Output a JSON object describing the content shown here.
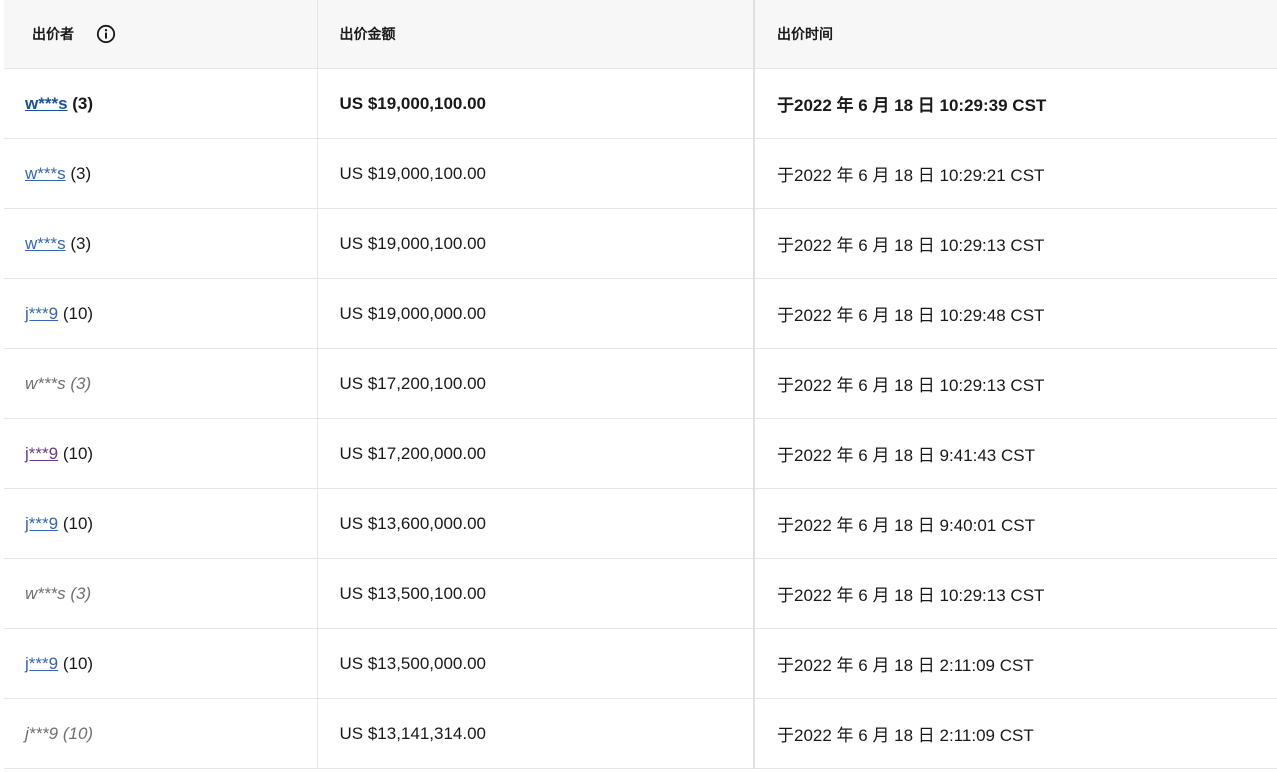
{
  "headers": {
    "bidder": "出价者",
    "amount": "出价金额",
    "time": "出价时间"
  },
  "rows": [
    {
      "bidder": "w***s",
      "feedback": "(3)",
      "amount": "US $19,000,100.00",
      "time": "于2022 年 6 月 18 日 10:29:39 CST",
      "style": "winning"
    },
    {
      "bidder": "w***s",
      "feedback": "(3)",
      "amount": "US $19,000,100.00",
      "time": "于2022 年 6 月 18 日 10:29:21 CST",
      "style": "link"
    },
    {
      "bidder": "w***s",
      "feedback": "(3)",
      "amount": "US $19,000,100.00",
      "time": "于2022 年 6 月 18 日 10:29:13 CST",
      "style": "link"
    },
    {
      "bidder": "j***9",
      "feedback": "(10)",
      "amount": "US $19,000,000.00",
      "time": "于2022 年 6 月 18 日 10:29:48 CST",
      "style": "link"
    },
    {
      "bidder": "w***s",
      "feedback": "(3)",
      "amount": "US $17,200,100.00",
      "time": "于2022 年 6 月 18 日 10:29:13 CST",
      "style": "auto"
    },
    {
      "bidder": "j***9",
      "feedback": "(10)",
      "amount": "US $17,200,000.00",
      "time": "于2022 年 6 月 18 日 9:41:43 CST",
      "style": "visited"
    },
    {
      "bidder": "j***9",
      "feedback": "(10)",
      "amount": "US $13,600,000.00",
      "time": "于2022 年 6 月 18 日 9:40:01 CST",
      "style": "link"
    },
    {
      "bidder": "w***s",
      "feedback": "(3)",
      "amount": "US $13,500,100.00",
      "time": "于2022 年 6 月 18 日 10:29:13 CST",
      "style": "auto"
    },
    {
      "bidder": "j***9",
      "feedback": "(10)",
      "amount": "US $13,500,000.00",
      "time": "于2022 年 6 月 18 日 2:11:09 CST",
      "style": "link"
    },
    {
      "bidder": "j***9",
      "feedback": "(10)",
      "amount": "US $13,141,314.00",
      "time": "于2022 年 6 月 18 日 2:11:09 CST",
      "style": "auto"
    }
  ],
  "colors": {
    "link": "#3665b3",
    "visited_link": "#6a3a8a",
    "auto_bid_text": "#707070",
    "header_bg": "#f7f7f7",
    "border": "#e5e5e5"
  },
  "icons": {
    "info": "info-circle-icon"
  }
}
